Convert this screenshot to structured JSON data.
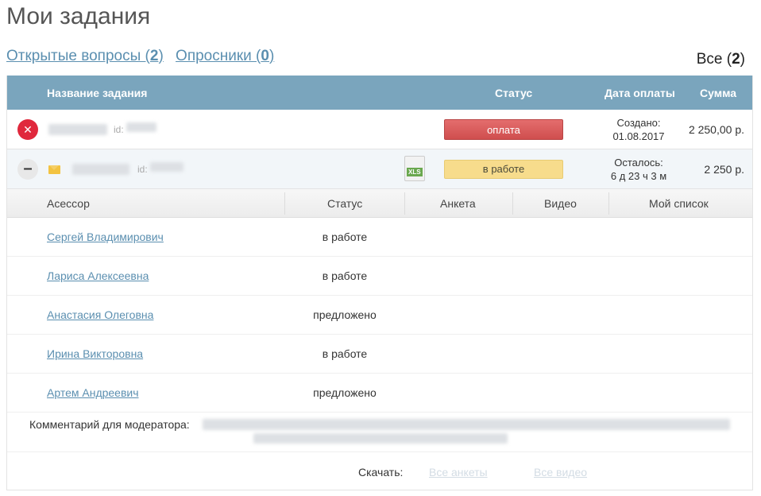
{
  "page_title": "Мои задания",
  "tabs": [
    {
      "label": "Открытые вопросы (",
      "count": "2",
      "close": ")"
    },
    {
      "label": "Опросники (",
      "count": "0",
      "close": ")"
    }
  ],
  "all": {
    "label": "Все (",
    "count": "2",
    "close": ")"
  },
  "table_header": {
    "name": "Название задания",
    "status": "Статус",
    "pay_date": "Дата оплаты",
    "sum": "Сумма"
  },
  "tasks": [
    {
      "id_label": "id:",
      "status": "оплата",
      "date_line1": "Создано:",
      "date_line2": "01.08.2017",
      "sum": "2 250,00 р."
    },
    {
      "id_label": "id:",
      "file_icon": "XLS",
      "status": "в работе",
      "date_line1": "Осталось:",
      "date_line2": "6 д 23 ч 3 м",
      "sum": "2 250 р."
    }
  ],
  "assessor_header": {
    "assessor": "Асессор",
    "status": "Статус",
    "form": "Анкета",
    "video": "Видео",
    "my_list": "Мой список"
  },
  "assessors": [
    {
      "name": "Сергей Владимирович",
      "status": "в работе"
    },
    {
      "name": "Лариса Алексеевна",
      "status": "в работе"
    },
    {
      "name": "Анастасия Олеговна",
      "status": "предложено"
    },
    {
      "name": "Ирина Викторовна",
      "status": "в работе"
    },
    {
      "name": "Артем Андреевич",
      "status": "предложено"
    }
  ],
  "comment_label": "Комментарий для модератора:",
  "download": {
    "label": "Скачать:",
    "all_forms": "Все анкеты",
    "all_videos": "Все видео"
  },
  "colors": {
    "header_bg": "#7aa5bd",
    "link": "#5b8fb0",
    "status_pay": "#d9595c",
    "status_work": "#f7dc8c",
    "cancel_icon": "#e0283c"
  }
}
